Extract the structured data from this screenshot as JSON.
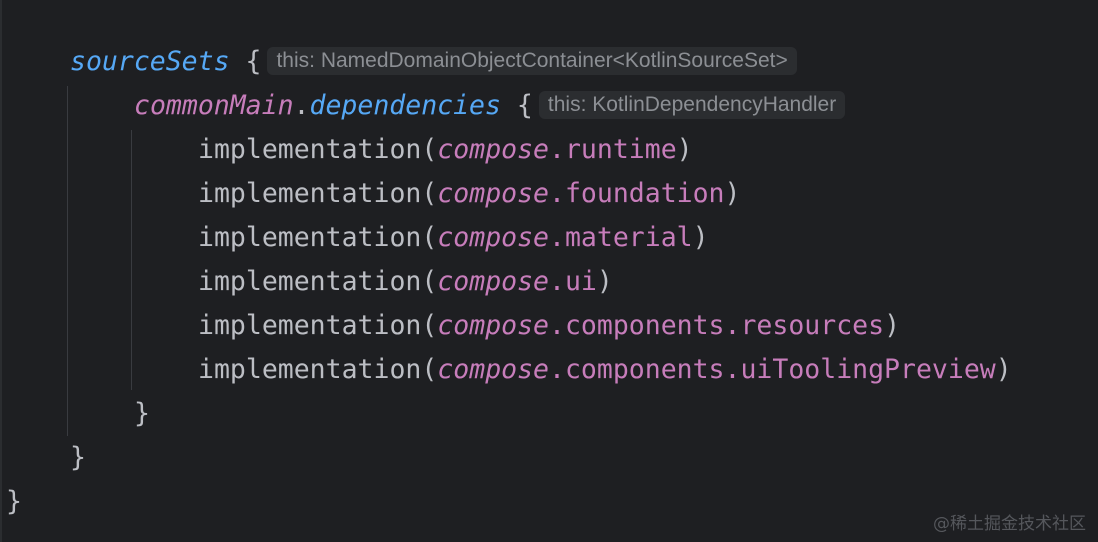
{
  "code": {
    "l1": {
      "ident": "sourceSets",
      "brace": " {",
      "hint": "this: NamedDomainObjectContainer<KotlinSourceSet>"
    },
    "l2": {
      "obj": "commonMain",
      "dot": ".",
      "ident": "dependencies",
      "brace": " {",
      "hint": "this: KotlinDependencyHandler"
    },
    "deps": [
      {
        "fn": "implementation(",
        "recv": "compose",
        "path": ".runtime",
        "close": ")"
      },
      {
        "fn": "implementation(",
        "recv": "compose",
        "path": ".foundation",
        "close": ")"
      },
      {
        "fn": "implementation(",
        "recv": "compose",
        "path": ".material",
        "close": ")"
      },
      {
        "fn": "implementation(",
        "recv": "compose",
        "path": ".ui",
        "close": ")"
      },
      {
        "fn": "implementation(",
        "recv": "compose",
        "path": ".components.resources",
        "close": ")"
      },
      {
        "fn": "implementation(",
        "recv": "compose",
        "path": ".components.uiToolingPreview",
        "close": ")"
      }
    ],
    "close_brace": "}"
  },
  "watermark": "@稀土掘金技术社区"
}
